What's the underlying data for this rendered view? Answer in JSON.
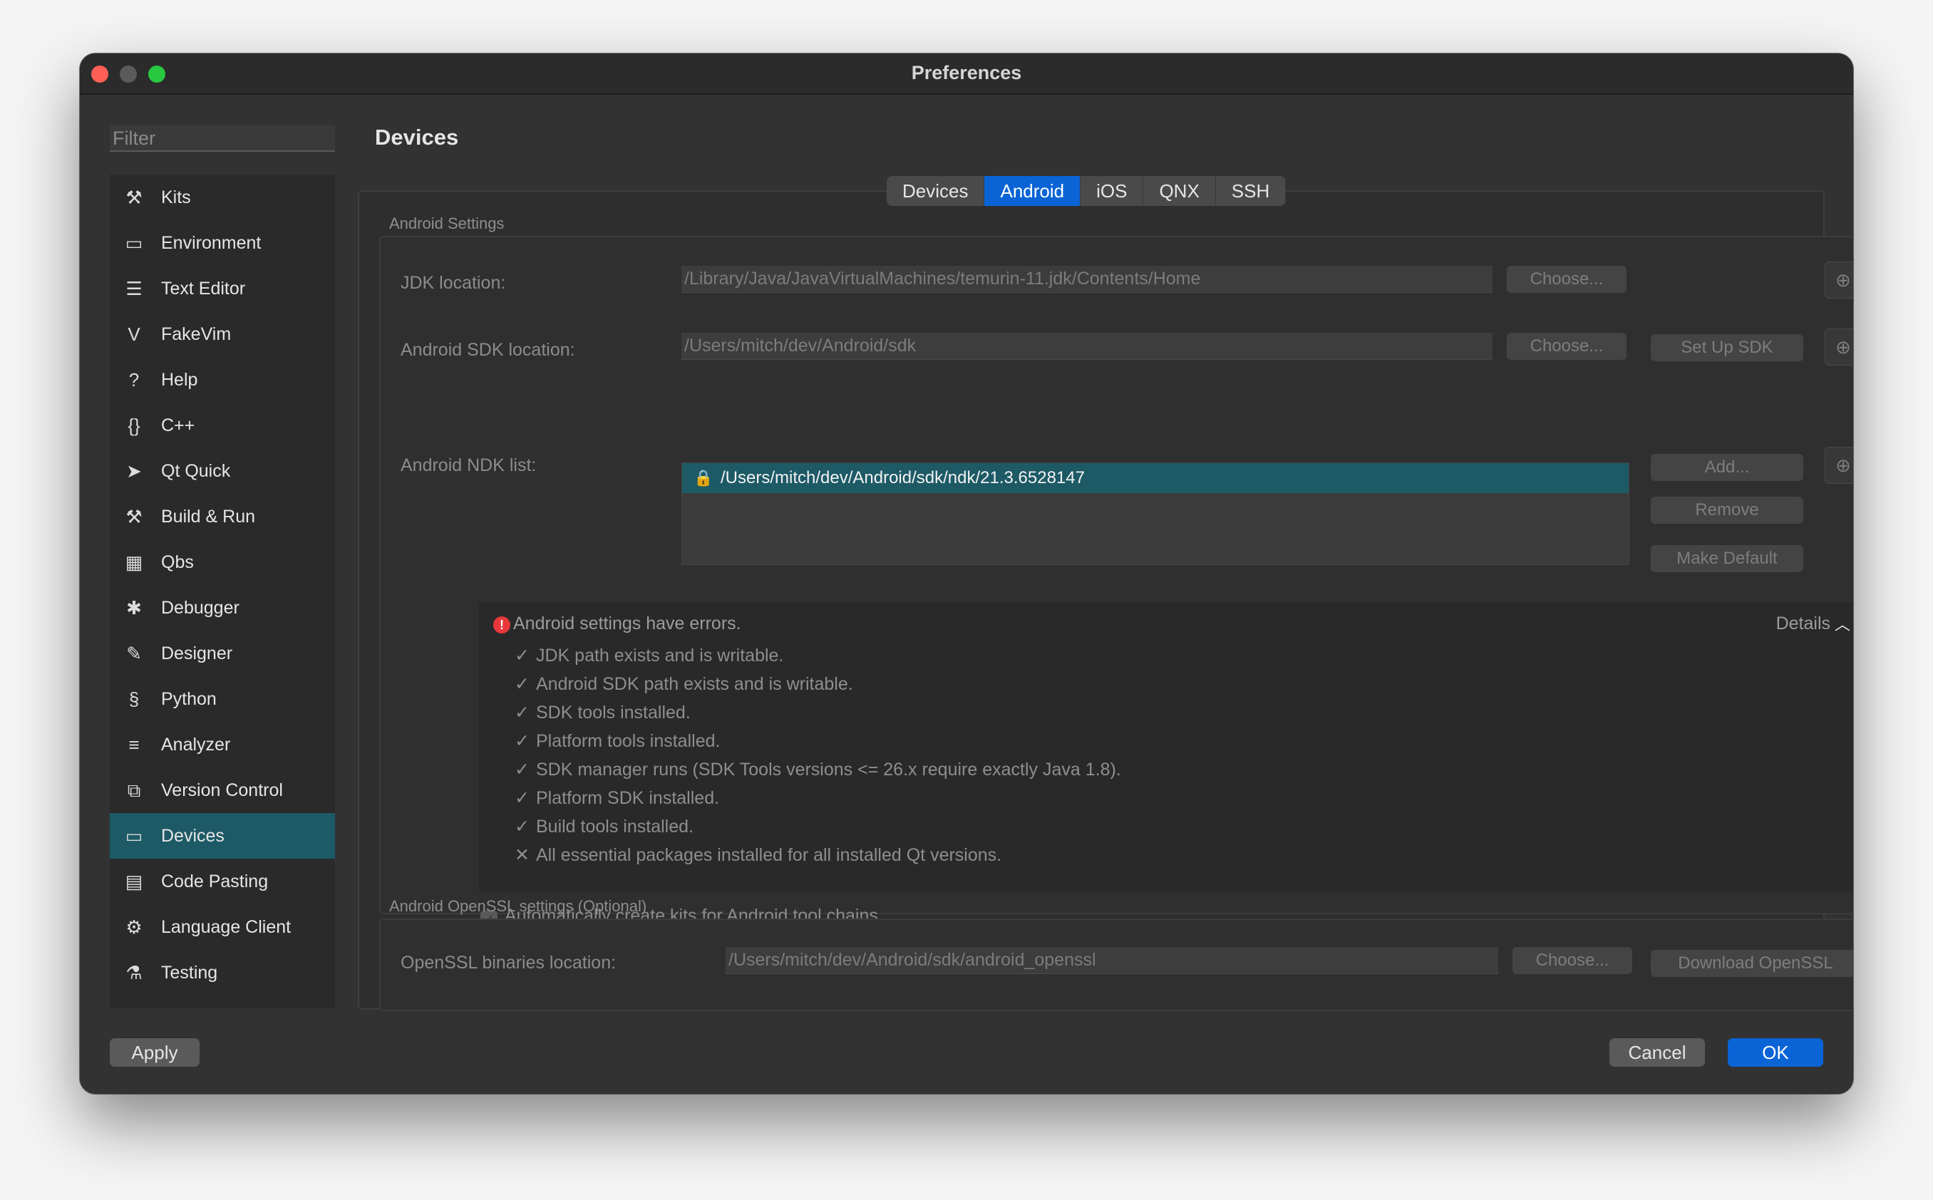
{
  "window": {
    "title": "Preferences"
  },
  "sidebar": {
    "filter_placeholder": "Filter",
    "items": [
      {
        "label": "Kits",
        "icon": "kits-icon",
        "glyph": "⚒"
      },
      {
        "label": "Environment",
        "icon": "monitor-icon",
        "glyph": "▭"
      },
      {
        "label": "Text Editor",
        "icon": "text-editor-icon",
        "glyph": "☰"
      },
      {
        "label": "FakeVim",
        "icon": "fakevim-icon",
        "glyph": "V"
      },
      {
        "label": "Help",
        "icon": "help-icon",
        "glyph": "?"
      },
      {
        "label": "C++",
        "icon": "braces-icon",
        "glyph": "{}"
      },
      {
        "label": "Qt Quick",
        "icon": "paper-plane-icon",
        "glyph": "➤"
      },
      {
        "label": "Build & Run",
        "icon": "hammer-icon",
        "glyph": "⚒"
      },
      {
        "label": "Qbs",
        "icon": "grid-icon",
        "glyph": "▦"
      },
      {
        "label": "Debugger",
        "icon": "bug-icon",
        "glyph": "✱"
      },
      {
        "label": "Designer",
        "icon": "pencil-icon",
        "glyph": "✎"
      },
      {
        "label": "Python",
        "icon": "python-icon",
        "glyph": "§"
      },
      {
        "label": "Analyzer",
        "icon": "analyzer-icon",
        "glyph": "≡"
      },
      {
        "label": "Version Control",
        "icon": "version-control-icon",
        "glyph": "⧉"
      },
      {
        "label": "Devices",
        "icon": "devices-icon",
        "glyph": "▭"
      },
      {
        "label": "Code Pasting",
        "icon": "clipboard-icon",
        "glyph": "▤"
      },
      {
        "label": "Language Client",
        "icon": "language-client-icon",
        "glyph": "⚙"
      },
      {
        "label": "Testing",
        "icon": "flask-icon",
        "glyph": "⚗"
      }
    ],
    "selected": "Devices"
  },
  "main": {
    "page_title": "Devices",
    "tabs": [
      "Devices",
      "Android",
      "iOS",
      "QNX",
      "SSH"
    ],
    "active_tab": "Android",
    "android_settings": {
      "group_title": "Android Settings",
      "jdk_label": "JDK location:",
      "jdk_path": "/Library/Java/JavaVirtualMachines/temurin-11.jdk/Contents/Home",
      "sdk_label": "Android SDK location:",
      "sdk_path": "/Users/mitch/dev/Android/sdk",
      "ndk_label": "Android NDK list:",
      "ndk_items": [
        "/Users/mitch/dev/Android/sdk/ndk/21.3.6528147"
      ],
      "choose_label": "Choose...",
      "setup_sdk_label": "Set Up SDK",
      "add_label": "Add...",
      "remove_label": "Remove",
      "make_default_label": "Make Default",
      "errors_title": "Android settings have errors.",
      "details_label": "Details",
      "checks": [
        {
          "mark": "✓",
          "text": "JDK path exists and is writable."
        },
        {
          "mark": "✓",
          "text": "Android SDK path exists and is writable."
        },
        {
          "mark": "✓",
          "text": "SDK tools installed."
        },
        {
          "mark": "✓",
          "text": "Platform tools installed."
        },
        {
          "mark": "✓",
          "text": "SDK manager runs (SDK Tools versions <= 26.x require exactly Java 1.8)."
        },
        {
          "mark": "✓",
          "text": "Platform SDK installed."
        },
        {
          "mark": "✓",
          "text": "Build tools installed."
        },
        {
          "mark": "✕",
          "text": "All essential packages installed for all installed Qt versions."
        }
      ],
      "auto_kits_label": "Automatically create kits for Android tool chains",
      "auto_kits_checked": true
    },
    "openssl": {
      "group_title": "Android OpenSSL settings (Optional)",
      "label": "OpenSSL binaries location:",
      "path": "/Users/mitch/dev/Android/sdk/android_openssl",
      "choose_label": "Choose...",
      "download_label": "Download OpenSSL"
    }
  },
  "footer": {
    "apply_label": "Apply",
    "cancel_label": "Cancel",
    "ok_label": "OK"
  },
  "colors": {
    "accent": "#0a64d6",
    "selection": "#1d5a66",
    "error": "#e8383b"
  }
}
